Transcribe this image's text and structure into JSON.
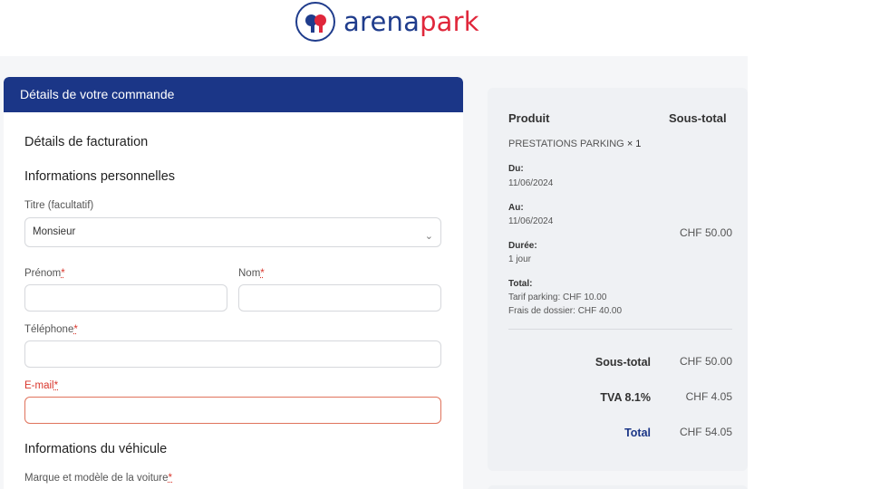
{
  "brand": {
    "name_part1": "arena",
    "name_part2": "park",
    "color_primary": "#1f3c8c",
    "color_accent": "#e0273b"
  },
  "order_card": {
    "header": "Détails de votre commande",
    "billing_title": "Détails de facturation",
    "personal_title": "Informations personnelles",
    "vehicle_title": "Informations du véhicule",
    "fields": {
      "title_label": "Titre (facultatif)",
      "title_value": "Monsieur",
      "firstname_label": "Prénom",
      "lastname_label": "Nom",
      "phone_label": "Téléphone",
      "email_label": "E-mail",
      "vehicle_label": "Marque et modèle de la voiture",
      "required_mark": "*"
    }
  },
  "summary": {
    "col_product": "Produit",
    "col_subtotal": "Sous-total",
    "product_name": "PRESTATIONS PARKING",
    "product_qty": "× 1",
    "from_label": "Du:",
    "from_value": "11/06/2024",
    "to_label": "Au:",
    "to_value": "11/06/2024",
    "duration_label": "Durée:",
    "duration_value": "1 jour",
    "total_label_small": "Total:",
    "tariff_line": "Tarif parking: CHF 10.00",
    "fees_line": "Frais de dossier: CHF 40.00",
    "line_price": "CHF 50.00",
    "subtotal_label": "Sous-total",
    "subtotal_value": "CHF 50.00",
    "vat_label": "TVA 8.1%",
    "vat_value": "CHF 4.05",
    "grand_total_label": "Total",
    "grand_total_value": "CHF 54.05"
  }
}
